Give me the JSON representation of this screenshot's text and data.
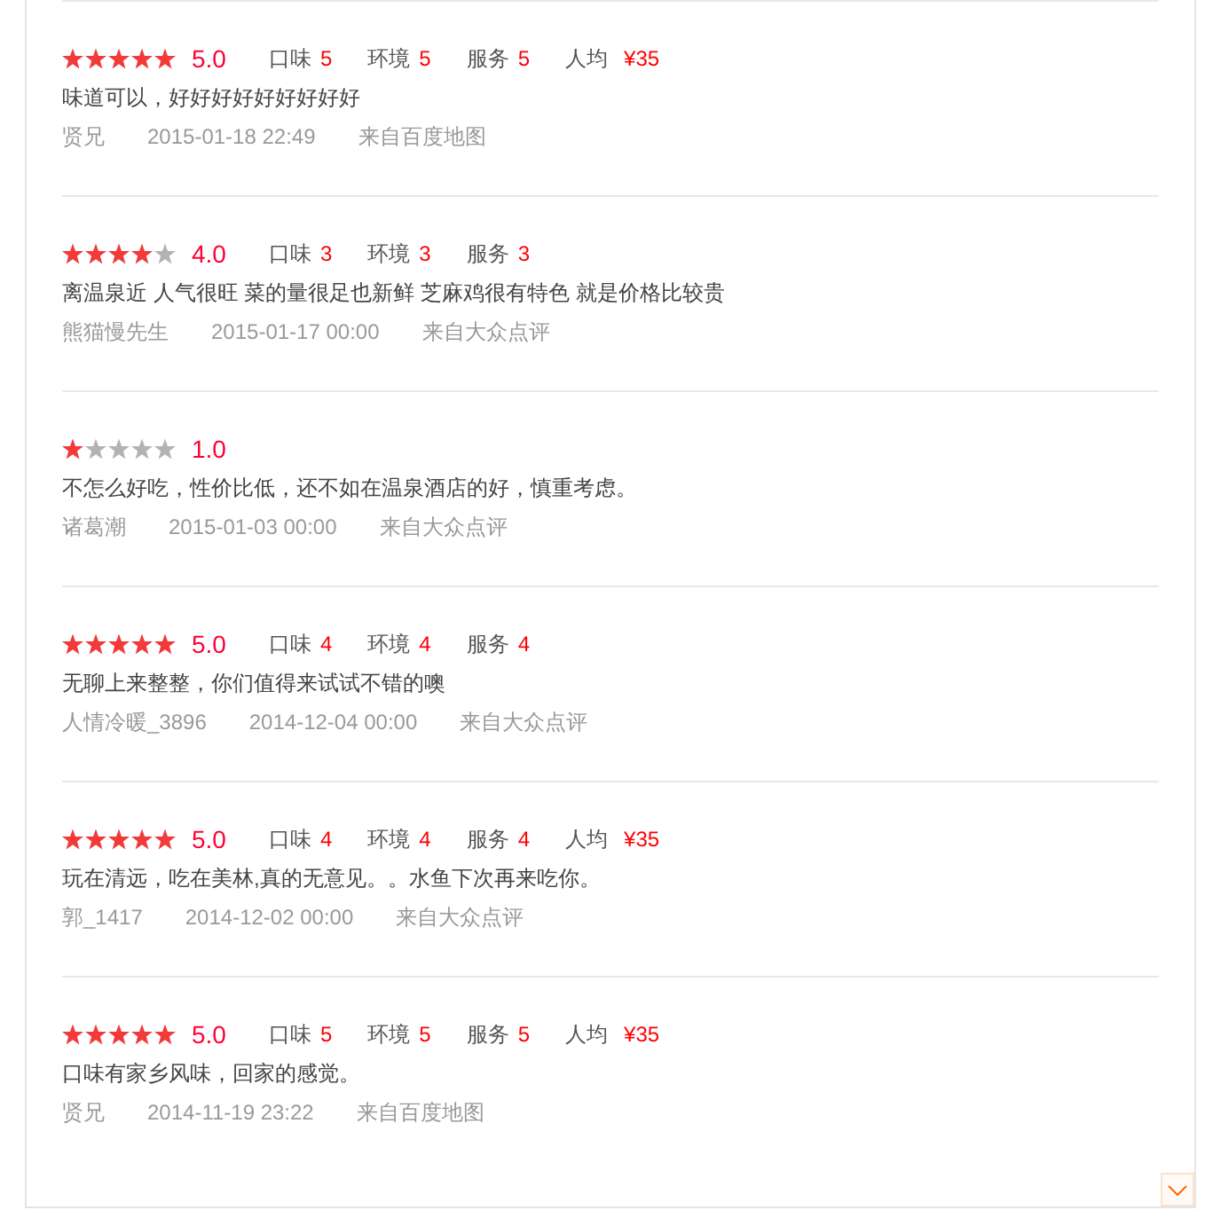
{
  "reviews": [
    {
      "stars": 5,
      "rating": "5.0",
      "scores": [
        {
          "label": "口味",
          "value": "5"
        },
        {
          "label": "环境",
          "value": "5"
        },
        {
          "label": "服务",
          "value": "5"
        }
      ],
      "price": {
        "label": "人均",
        "value": "¥35"
      },
      "comment": "味道可以，好好好好好好好好好",
      "author": "贤兄",
      "time": "2015-01-18 22:49",
      "source": "来自百度地图"
    },
    {
      "stars": 4,
      "rating": "4.0",
      "scores": [
        {
          "label": "口味",
          "value": "3"
        },
        {
          "label": "环境",
          "value": "3"
        },
        {
          "label": "服务",
          "value": "3"
        }
      ],
      "comment": "离温泉近 人气很旺 菜的量很足也新鲜 芝麻鸡很有特色 就是价格比较贵",
      "author": "熊猫慢先生",
      "time": "2015-01-17 00:00",
      "source": "来自大众点评"
    },
    {
      "stars": 1,
      "rating": "1.0",
      "comment": "不怎么好吃，性价比低，还不如在温泉酒店的好，慎重考虑。",
      "author": "诸葛潮",
      "time": "2015-01-03 00:00",
      "source": "来自大众点评"
    },
    {
      "stars": 5,
      "rating": "5.0",
      "scores": [
        {
          "label": "口味",
          "value": "4"
        },
        {
          "label": "环境",
          "value": "4"
        },
        {
          "label": "服务",
          "value": "4"
        }
      ],
      "comment": "无聊上来整整，你们值得来试试不错的噢",
      "author": "人情冷暖_3896",
      "time": "2014-12-04 00:00",
      "source": "来自大众点评"
    },
    {
      "stars": 5,
      "rating": "5.0",
      "scores": [
        {
          "label": "口味",
          "value": "4"
        },
        {
          "label": "环境",
          "value": "4"
        },
        {
          "label": "服务",
          "value": "4"
        }
      ],
      "price": {
        "label": "人均",
        "value": "¥35"
      },
      "comment": "玩在清远，吃在美林,真的无意见。。水鱼下次再来吃你。",
      "author": "郭_1417",
      "time": "2014-12-02 00:00",
      "source": "来自大众点评"
    },
    {
      "stars": 5,
      "rating": "5.0",
      "scores": [
        {
          "label": "口味",
          "value": "5"
        },
        {
          "label": "环境",
          "value": "5"
        },
        {
          "label": "服务",
          "value": "5"
        }
      ],
      "price": {
        "label": "人均",
        "value": "¥35"
      },
      "comment": "口味有家乡风味，回家的感觉。",
      "author": "贤兄",
      "time": "2014-11-19 23:22",
      "source": "来自百度地图"
    }
  ]
}
